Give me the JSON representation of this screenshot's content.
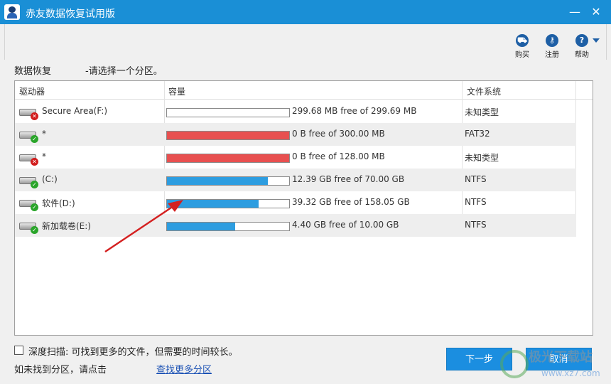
{
  "window": {
    "title": "赤友数据恢复试用版",
    "minimize": "—",
    "close": "✕"
  },
  "toolbar": {
    "buy_label": "购买",
    "register_label": "注册",
    "help_label": "帮助"
  },
  "header": {
    "title": "数据恢复",
    "subtitle": "-请选择一个分区。"
  },
  "table": {
    "columns": [
      "驱动器",
      "容量",
      "文件系统"
    ],
    "rows": [
      {
        "name": "Secure Area(F:)",
        "status": "error",
        "used_fraction": 0.0003,
        "capacity": "299.68 MB free of 299.69 MB",
        "fs": "未知类型",
        "bar_color": "#2d9de0"
      },
      {
        "name": "*",
        "status": "ok",
        "used_fraction": 1.0,
        "capacity": "0 B free of 300.00 MB",
        "fs": "FAT32",
        "bar_color": "#e85050"
      },
      {
        "name": "*",
        "status": "error",
        "used_fraction": 1.0,
        "capacity": "0 B free of 128.00 MB",
        "fs": "未知类型",
        "bar_color": "#e85050"
      },
      {
        "name": "(C:)",
        "status": "ok",
        "used_fraction": 0.823,
        "capacity": "12.39 GB free of 70.00 GB",
        "fs": "NTFS",
        "bar_color": "#2d9de0"
      },
      {
        "name": "软件(D:)",
        "status": "ok",
        "used_fraction": 0.751,
        "capacity": "39.32 GB free of 158.05 GB",
        "fs": "NTFS",
        "bar_color": "#2d9de0"
      },
      {
        "name": "新加载卷(E:)",
        "status": "ok",
        "used_fraction": 0.56,
        "capacity": "4.40 GB free of 10.00 GB",
        "fs": "NTFS",
        "bar_color": "#2d9de0"
      }
    ]
  },
  "footer": {
    "deep_scan_label": "深度扫描: 可找到更多的文件，但需要的时间较长。",
    "not_found_label": "如未找到分区，请点击",
    "more_link": "查找更多分区",
    "next_button": "下一步",
    "cancel_button": "取消"
  },
  "watermark": {
    "text": "极光下载站",
    "url": "www.xz7.com"
  },
  "colors": {
    "titlebar": "#1a8fd6",
    "accent_blue": "#2d9de0",
    "full_red": "#e85050",
    "arrow_red": "#d42020"
  }
}
